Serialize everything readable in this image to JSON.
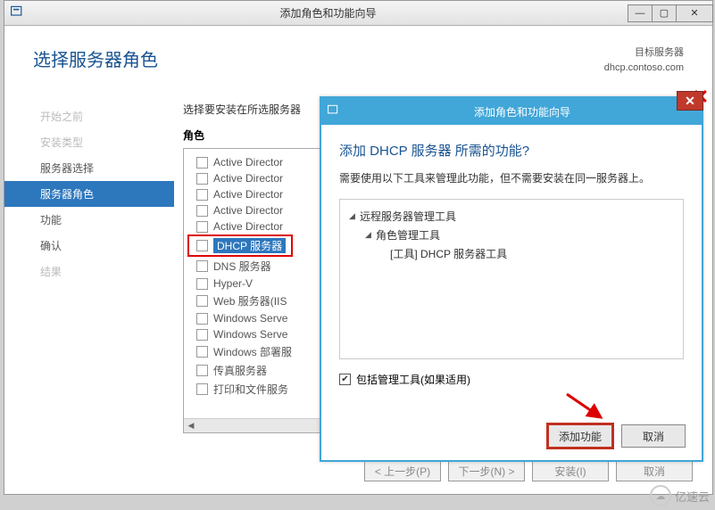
{
  "parent": {
    "title": "添加角色和功能向导",
    "page_title": "选择服务器角色",
    "target_label": "目标服务器",
    "target_server": "dhcp.contoso.com",
    "instruction": "选择要安装在所选服务器",
    "roles_label": "角色"
  },
  "sidebar": {
    "items": [
      {
        "label": "开始之前",
        "cls": "side-item"
      },
      {
        "label": "安装类型",
        "cls": "side-item"
      },
      {
        "label": "服务器选择",
        "cls": "side-item enabled"
      },
      {
        "label": "服务器角色",
        "cls": "side-item active"
      },
      {
        "label": "功能",
        "cls": "side-item enabled"
      },
      {
        "label": "确认",
        "cls": "side-item enabled"
      },
      {
        "label": "结果",
        "cls": "side-item"
      }
    ]
  },
  "roles": [
    "Active Director",
    "Active Director",
    "Active Director",
    "Active Director",
    "Active Director",
    "DHCP 服务器",
    "DNS 服务器",
    "Hyper-V",
    "Web 服务器(IIS",
    "Windows Serve",
    "Windows Serve",
    "Windows 部署服",
    "传真服务器",
    "打印和文件服务"
  ],
  "buttons": {
    "prev": "< 上一步(P)",
    "next": "下一步(N) >",
    "install": "安装(I)",
    "cancel": "取消"
  },
  "sub": {
    "title": "添加角色和功能向导",
    "heading": "添加 DHCP 服务器 所需的功能?",
    "desc": "需要使用以下工具来管理此功能，但不需要安装在同一服务器上。",
    "tree": {
      "n1": "远程服务器管理工具",
      "n2": "角色管理工具",
      "n3": "[工具] DHCP 服务器工具"
    },
    "include": "包括管理工具(如果适用)",
    "add": "添加功能",
    "cancel": "取消"
  },
  "watermark": "亿速云"
}
